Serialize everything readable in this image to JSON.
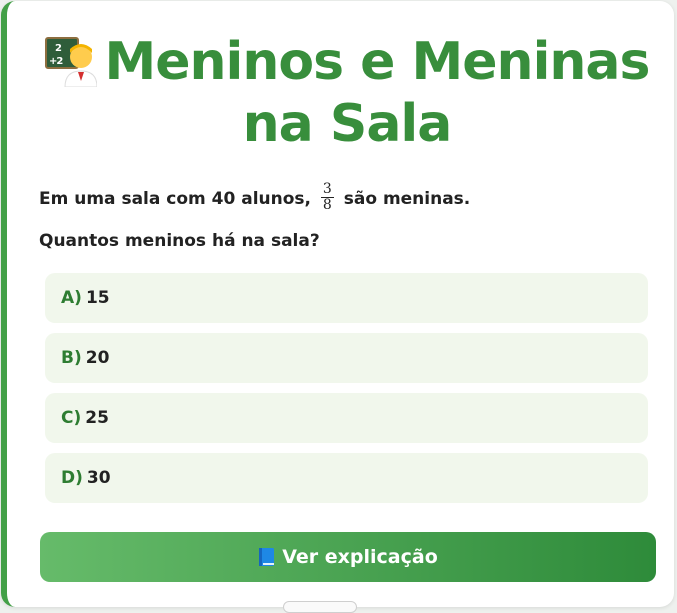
{
  "title": {
    "text": "Meninos e Meninas na Sala",
    "icon": "teacher-emoji-icon"
  },
  "question": {
    "prefix": "Em uma sala com 40 alunos,",
    "fraction_numerator": "3",
    "fraction_denominator": "8",
    "suffix": "são meninas.",
    "prompt": "Quantos meninos há na sala?"
  },
  "options": [
    {
      "letter": "A",
      "paren": ")",
      "value": "15"
    },
    {
      "letter": "B",
      "paren": ")",
      "value": "20"
    },
    {
      "letter": "C",
      "paren": ")",
      "value": "25"
    },
    {
      "letter": "D",
      "paren": ")",
      "value": "30"
    }
  ],
  "explain_button": {
    "label": "Ver explicação",
    "icon": "blue-book-icon"
  },
  "colors": {
    "accent": "#43a047",
    "title": "#388e3c",
    "option_bg": "#f1f7ec",
    "button_start": "#66bb6a",
    "button_end": "#2e8b3a"
  }
}
